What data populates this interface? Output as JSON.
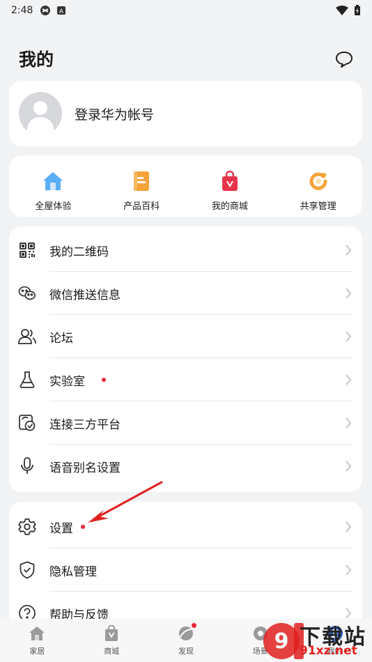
{
  "status": {
    "time": "2:48"
  },
  "header": {
    "title": "我的"
  },
  "profile": {
    "name": "登录华为帐号"
  },
  "quick": [
    {
      "label": "全屋体验",
      "icon": "house-icon",
      "color": "#5aaef5"
    },
    {
      "label": "产品百科",
      "icon": "book-icon",
      "color": "#f5a33a"
    },
    {
      "label": "我的商城",
      "icon": "shopping-bag-icon",
      "color": "#e8344a"
    },
    {
      "label": "共享管理",
      "icon": "share-refresh-icon",
      "color": "#f5a33a"
    }
  ],
  "menu1": [
    {
      "label": "我的二维码",
      "icon": "qr-code-icon"
    },
    {
      "label": "微信推送信息",
      "icon": "wechat-icon"
    },
    {
      "label": "论坛",
      "icon": "users-icon"
    },
    {
      "label": "实验室",
      "icon": "flask-icon",
      "dot": true
    },
    {
      "label": "连接三方平台",
      "icon": "platform-link-icon"
    },
    {
      "label": "语音别名设置",
      "icon": "microphone-icon"
    }
  ],
  "menu2": [
    {
      "label": "设置",
      "icon": "gear-icon",
      "dot": true
    },
    {
      "label": "隐私管理",
      "icon": "shield-check-icon"
    },
    {
      "label": "帮助与反馈",
      "icon": "help-icon"
    }
  ],
  "tabs": [
    {
      "label": "家居",
      "icon": "home-tab-icon"
    },
    {
      "label": "商城",
      "icon": "mall-tab-icon"
    },
    {
      "label": "发现",
      "icon": "discover-tab-icon",
      "dot": true
    },
    {
      "label": "场景",
      "icon": "scene-tab-icon"
    },
    {
      "label": "我的",
      "icon": "me-tab-icon"
    }
  ],
  "watermark": {
    "cn": "下载站",
    "url": "91xz.net"
  },
  "colors": {
    "accent_red": "#e8283a",
    "background": "#f1f3f5",
    "card": "#ffffff"
  }
}
